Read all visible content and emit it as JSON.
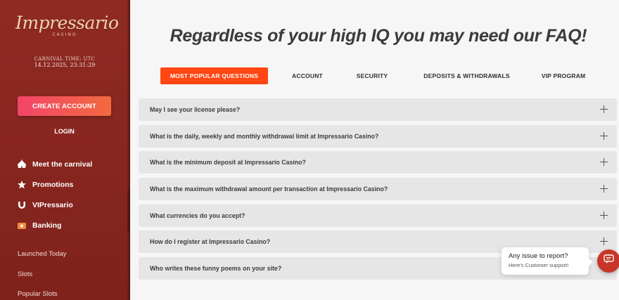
{
  "sidebar": {
    "logo": {
      "main": "Impressario",
      "sub": "CASINO"
    },
    "carnival_time_label": "CARNIVAL TIME: UTC",
    "carnival_time_value": "14.12.2025, 23:31:29",
    "create_account": "CREATE ACCOUNT",
    "login": "LOGIN",
    "nav": [
      {
        "label": "Meet the carnival",
        "icon": "tent-icon"
      },
      {
        "label": "Promotions",
        "icon": "star-badge-icon"
      },
      {
        "label": "VIPressario",
        "icon": "horseshoe-icon"
      },
      {
        "label": "Banking",
        "icon": "wallet-icon"
      }
    ],
    "links": [
      "Launched Today",
      "Slots",
      "Popular Slots"
    ]
  },
  "main": {
    "title": "Regardless of your high IQ you may need our FAQ!",
    "tabs": [
      {
        "label": "MOST POPULAR QUESTIONS",
        "active": true
      },
      {
        "label": "ACCOUNT",
        "active": false
      },
      {
        "label": "SECURITY",
        "active": false
      },
      {
        "label": "DEPOSITS & WITHDRAWALS",
        "active": false
      },
      {
        "label": "VIP PROGRAM",
        "active": false
      }
    ],
    "questions": [
      "May I see your license please?",
      "What is the daily, weekly and monthly withdrawal limit at Impressario Casino?",
      "What is the minimum deposit at Impressario Casino?",
      "What is the maximum withdrawal amount per transaction at Impressario Casino?",
      "What currencies do you accept?",
      "How do I register at Impressario Casino?",
      "Who writes these funny poems on your site?"
    ]
  },
  "chat": {
    "title": "Any issue to report?",
    "subtitle": "Here's Customer support!",
    "icon": "chat-icon"
  },
  "colors": {
    "sidebar_bg": "#8f2a22",
    "accent_tab": "#ff4613",
    "cta_gradient_start": "#f2456a",
    "cta_gradient_end": "#f26a3e",
    "chat_button": "#c8362a"
  }
}
